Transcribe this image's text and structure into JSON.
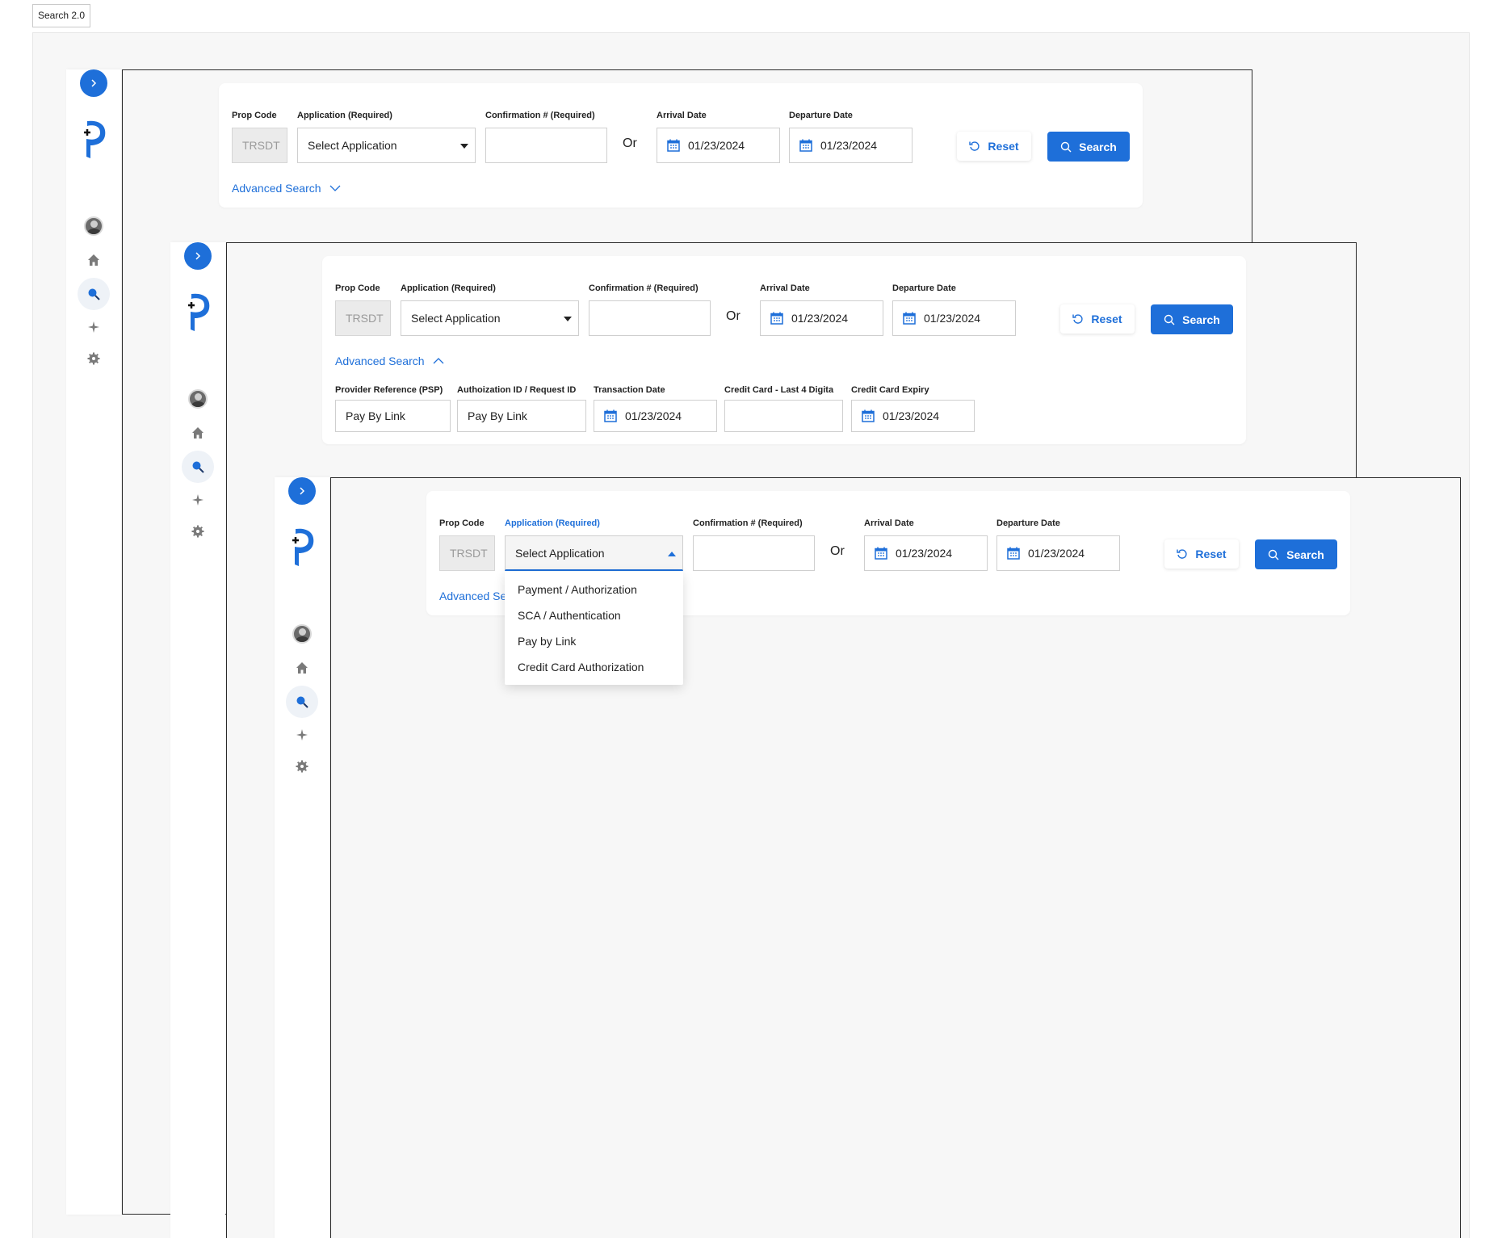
{
  "page_tag": "Search 2.0",
  "colors": {
    "accent": "#1e6fd9",
    "frame_border": "#2b2b2b",
    "disabled_bg": "#ebebeb"
  },
  "icons": {
    "toggle": "chevron-right-icon",
    "logo": "p-plus-logo",
    "nav": [
      "avatar",
      "home-icon",
      "search-icon",
      "sparkle-icon",
      "gear-icon"
    ],
    "date": "calendar-icon",
    "reset": "refresh-icon",
    "search": "search-icon"
  },
  "form": {
    "prop_code_label": "Prop Code",
    "prop_code_value": "TRSDT",
    "application_label": "Application (Required)",
    "application_value": "Select Application",
    "confirmation_label": "Confirmation # (Required)",
    "confirmation_value": "",
    "or_text": "Or",
    "arrival_label": "Arrival Date",
    "arrival_value": "01/23/2024",
    "departure_label": "Departure Date",
    "departure_value": "01/23/2024",
    "reset_label": "Reset",
    "search_label": "Search",
    "advanced_label": "Advanced Search",
    "advanced_label_truncated": "Advanced Se"
  },
  "advanced": {
    "provider_ref_label": "Provider Reference (PSP)",
    "provider_ref_value": "Pay By Link",
    "auth_id_label": "Authoization ID / Request ID",
    "auth_id_value": "Pay By Link",
    "transaction_date_label": "Transaction Date",
    "transaction_date_value": "01/23/2024",
    "cc_last4_label": "Credit Card - Last 4 Digita",
    "cc_last4_value": "",
    "cc_expiry_label": "Credit Card Expiry",
    "cc_expiry_value": "01/23/2024"
  },
  "application_options": [
    "Payment / Authorization",
    "SCA / Authentication",
    "Pay by Link",
    "Credit Card Authorization"
  ]
}
